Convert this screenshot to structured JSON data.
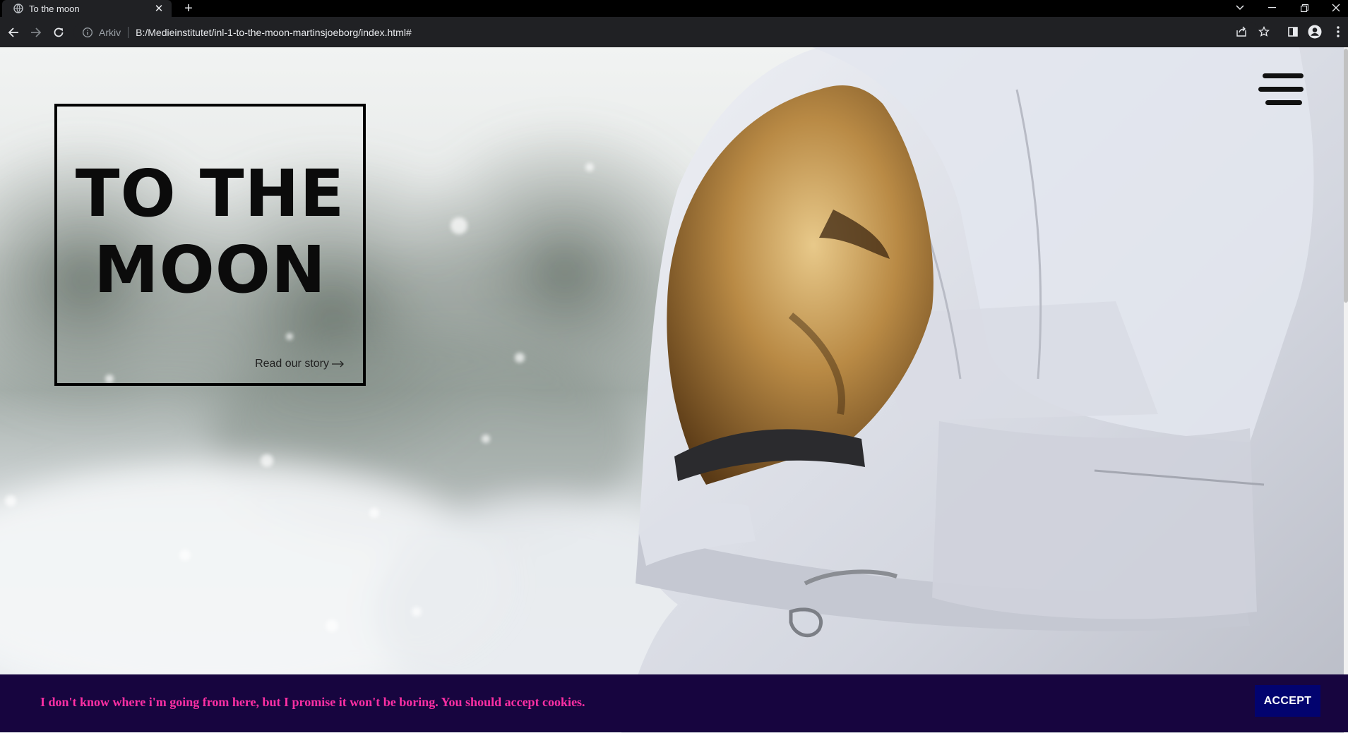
{
  "browser": {
    "tab_title": "To the moon",
    "tab_favicon": "globe-icon",
    "close_tab": "✕",
    "new_tab": "+",
    "omnibox_chip": "Arkiv",
    "url": "B:/Medieinstitutet/inl-1-to-the-moon-martinsjoeborg/index.html#"
  },
  "hero": {
    "title_line1": "TO THE",
    "title_line2": "MOON",
    "story_link": "Read our story",
    "menu_icon": "hamburger-menu-icon",
    "image": "astronaut-helmet-photo"
  },
  "cookie": {
    "message": "I don't know where i'm going from here, but I promise it won't be boring. You should accept cookies.",
    "accept_label": "ACCEPT"
  },
  "colors": {
    "cookie_bg": "#17053f",
    "cookie_text": "#ff2fa4",
    "accept_bg": "#02036f",
    "chrome_bg": "#202124"
  }
}
